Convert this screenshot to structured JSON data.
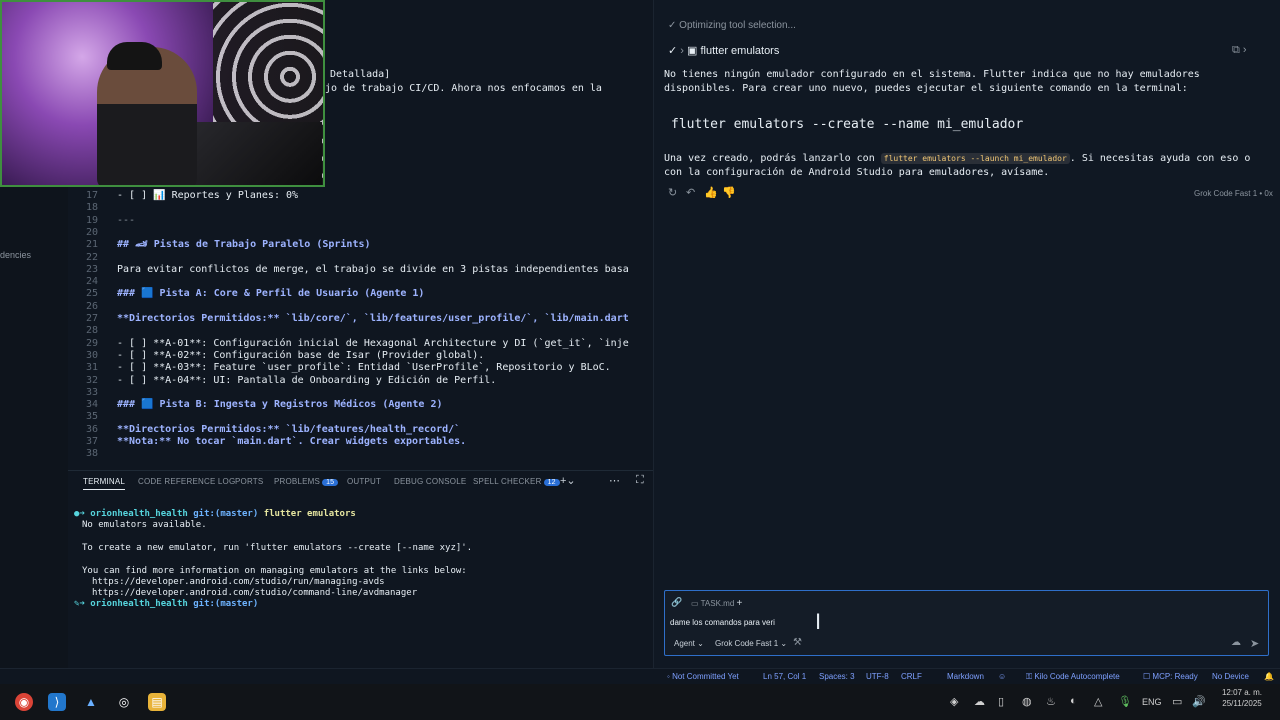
{
  "left_strip": {
    "fragment": "dencies"
  },
  "editor_top": {
    "line1": "Detallada]",
    "line2": "jo de trabajo CI/CD. Ahora nos enfocamos en la"
  },
  "editor": {
    "lines": [
      {
        "n": "17",
        "text": "- [ ] 📊 Reportes y Planes: 0%"
      },
      {
        "n": "18",
        "text": ""
      },
      {
        "n": "19",
        "text": "---"
      },
      {
        "n": "20",
        "text": ""
      },
      {
        "n": "21",
        "text": "## 🏎 Pistas de Trabajo Paralelo (Sprints)"
      },
      {
        "n": "22",
        "text": ""
      },
      {
        "n": "23",
        "text": "Para evitar conflictos de merge, el trabajo se divide en 3 pistas independientes basa"
      },
      {
        "n": "24",
        "text": ""
      },
      {
        "n": "25",
        "text": "### 🟦 Pista A: Core & Perfil de Usuario (Agente 1)"
      },
      {
        "n": "26",
        "text": ""
      },
      {
        "n": "27",
        "text": "**Directorios Permitidos:** `lib/core/`, `lib/features/user_profile/`, `lib/main.dart"
      },
      {
        "n": "28",
        "text": ""
      },
      {
        "n": "29",
        "text": "- [ ] **A-01**: Configuración inicial de Hexagonal Architecture y DI (`get_it`, `inje"
      },
      {
        "n": "30",
        "text": "- [ ] **A-02**: Configuración base de Isar (Provider global)."
      },
      {
        "n": "31",
        "text": "- [ ] **A-03**: Feature `user_profile`: Entidad `UserProfile`, Repositorio y BLoC."
      },
      {
        "n": "32",
        "text": "- [ ] **A-04**: UI: Pantalla de Onboarding y Edición de Perfil."
      },
      {
        "n": "33",
        "text": ""
      },
      {
        "n": "34",
        "text": "### 🟦 Pista B: Ingesta y Registros Médicos (Agente 2)"
      },
      {
        "n": "35",
        "text": ""
      },
      {
        "n": "36",
        "text": "**Directorios Permitidos:** `lib/features/health_record/`"
      },
      {
        "n": "37",
        "text": "**Nota:** No tocar `main.dart`. Crear widgets exportables."
      },
      {
        "n": "38",
        "text": ""
      }
    ]
  },
  "panel": {
    "tabs": [
      {
        "label": "TERMINAL",
        "active": true
      },
      {
        "label": "CODE REFERENCE LOG"
      },
      {
        "label": "PORTS"
      },
      {
        "label": "PROBLEMS",
        "badge": "15"
      },
      {
        "label": "OUTPUT"
      },
      {
        "label": "DEBUG CONSOLE"
      },
      {
        "label": "SPELL CHECKER",
        "badge": "12"
      }
    ],
    "terminal": {
      "prompt_dir": "orionhealth_health",
      "git": "git:(master)",
      "cmd": "flutter emulators",
      "out1": "No emulators available.",
      "out2": "To create a new emulator, run 'flutter emulators --create [--name xyz]'.",
      "out3": "You can find more information on managing emulators at the links below:",
      "link1": "https://developer.android.com/studio/run/managing-avds",
      "link2": "https://developer.android.com/studio/command-line/avdmanager"
    }
  },
  "chat": {
    "step1": "Optimizing tool selection...",
    "step2": "flutter emulators",
    "para1": "No tienes ningún emulador configurado en el sistema. Flutter indica que no hay emuladores disponibles. Para crear uno nuevo, puedes ejecutar el siguiente comando en la terminal:",
    "command": "flutter emulators --create --name mi_emulador",
    "para2a": "Una vez creado, podrás lanzarlo con ",
    "para2code": "flutter emulators --launch mi_emulador",
    "para2b": ". Si necesitas ayuda con eso o con la configuración de Android Studio para emuladores, avísame.",
    "model_footer": "Grok Code Fast 1 • 0x",
    "input": {
      "attachment": "TASK.md",
      "text": "dame los comandos para veri",
      "mode": "Agent",
      "model": "Grok Code Fast 1"
    }
  },
  "statusbar": {
    "commit": "Not Committed Yet",
    "position": "Ln 57, Col 1",
    "spaces": "Spaces: 3",
    "encoding": "UTF-8",
    "eol": "CRLF",
    "language": "Markdown",
    "kilo": "Kilo Code Autocomplete",
    "mcp": "MCP: Ready",
    "device": "No Device"
  },
  "taskbar": {
    "lang": "ENG",
    "time": "12:07 a. m.",
    "date": "25/11/2025"
  }
}
